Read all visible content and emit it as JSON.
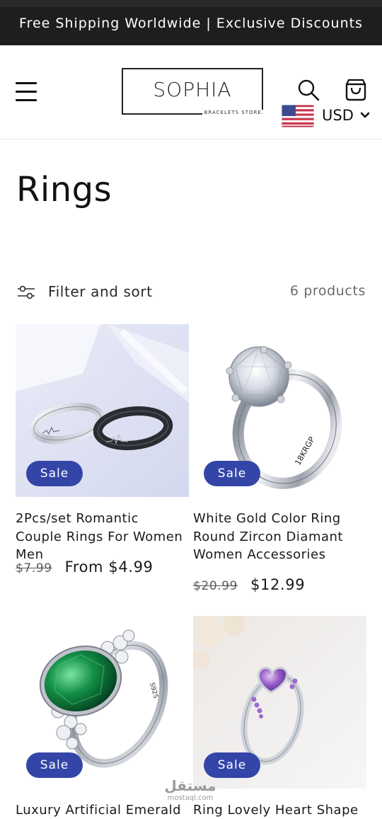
{
  "announcement": "Free Shipping Worldwide | Exclusive Discounts",
  "header": {
    "logo_name": "SOPHIA",
    "logo_sub": "BRACELETS STORE.",
    "currency": "USD",
    "icons": [
      "menu-icon",
      "search-icon",
      "cart-icon",
      "us-flag-icon",
      "chevron-down-icon"
    ]
  },
  "collection": {
    "title": "Rings",
    "filter_label": "Filter and sort",
    "product_count": "6 products"
  },
  "products": [
    {
      "badge": "Sale",
      "title": "2Pcs/set Romantic Couple Rings For Women Men",
      "price_old": "$7.99",
      "price_new": "From $4.99",
      "image": "couple-rings-silver-black"
    },
    {
      "badge": "Sale",
      "title": "White Gold Color Ring Round Zircon Diamant Women Accessories",
      "price_old": "$20.99",
      "price_new": "$12.99",
      "image": "solitaire-diamond-ring",
      "engraving": "18KRGP"
    },
    {
      "badge": "Sale",
      "title": "Luxury Artificial Emerald",
      "image": "emerald-ring",
      "engraving": "S925"
    },
    {
      "badge": "Sale",
      "title": "Ring Lovely Heart Shape",
      "image": "purple-heart-ring"
    }
  ],
  "watermark": {
    "arabic": "مستقل",
    "latin": "mostaql.com"
  },
  "colors": {
    "announcement_bg": "#1e1e1e",
    "sale_badge": "#3445a8",
    "text": "#121212"
  }
}
